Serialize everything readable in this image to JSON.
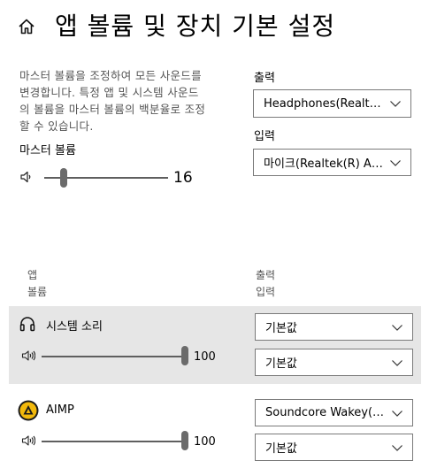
{
  "header": {
    "title": "앱 볼륨 및 장치 기본 설정",
    "home_icon": "home-icon"
  },
  "master": {
    "description_lines": [
      "마스터 볼륨을 조정하여 모든 사운드를",
      "변경합니다. 특정 앱 및 시스템 사운드",
      "의 볼륨을 마스터 볼륨의 백분율로 조정",
      "할 수 있습니다."
    ],
    "label": "마스터 볼륨",
    "value": "16",
    "level": 0.16
  },
  "output": {
    "label": "출력",
    "selected": "Headphones(Realtek(R) Audio)"
  },
  "input": {
    "label": "입력",
    "selected": "마이크(Realtek(R) Audio)"
  },
  "columns": {
    "app": "앱",
    "volume": "볼륨",
    "output": "출력",
    "input": "입력"
  },
  "apps": [
    {
      "name": "시스템 소리",
      "icon": "headphones-icon",
      "volume": "100",
      "level": 1.0,
      "output": "기본값",
      "input": "기본값"
    },
    {
      "name": "AIMP",
      "icon": "aimp-logo-icon",
      "volume": "100",
      "level": 1.0,
      "output": "Soundcore Wakey(Soundcore Wakey)",
      "input": "기본값"
    }
  ],
  "colors": {
    "row_highlight": "#e6e6e6",
    "border": "#7a7a7a",
    "aimp_yellow": "#f2b90c"
  }
}
